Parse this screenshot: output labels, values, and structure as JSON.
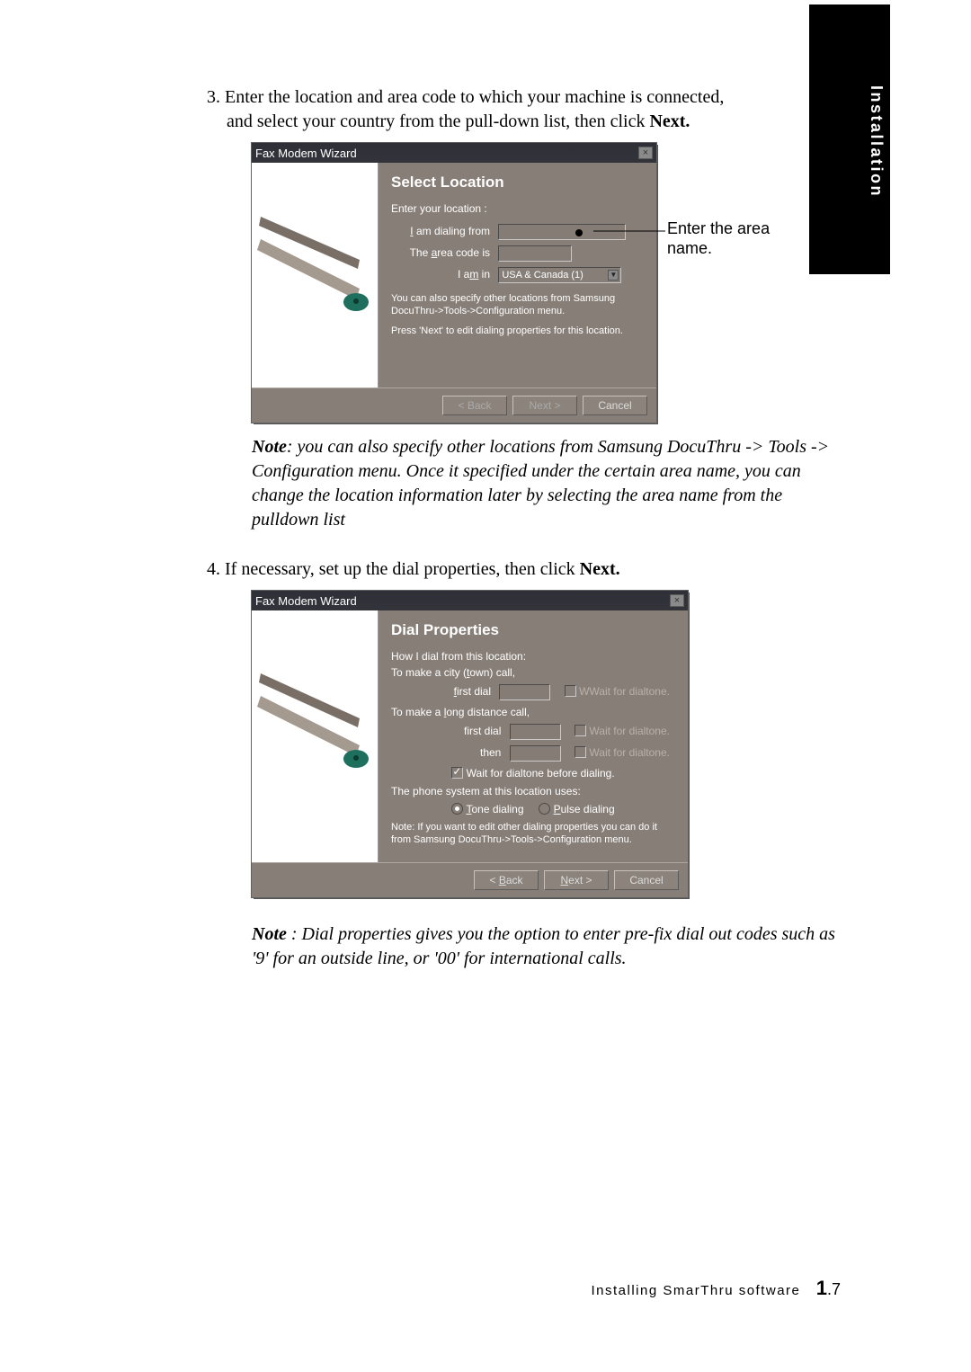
{
  "sideLabel": "Installation",
  "step3": {
    "lead": "3. Enter the location and area code to which your machine is connected,",
    "cont": "and select your country from the pull-down list, then click ",
    "nextWord": "Next."
  },
  "callout": {
    "line1": "Enter the area",
    "line2": "name."
  },
  "wiz1": {
    "title": "Fax Modem Wizard",
    "heading": "Select Location",
    "enterLoc": "Enter your location :",
    "dialFrom_u": "I",
    "dialFrom_rest": " am dialing from",
    "areaCode_u": "a",
    "areaCode_pre": "The ",
    "areaCode_post": "rea code is",
    "iamin_u": "m",
    "iamin_pre": "I a",
    "iamin_post": " in",
    "country": "USA & Canada (1)",
    "note1": "You can also specify other locations from Samsung DocuThru->Tools->Configuration menu.",
    "note2": "Press 'Next' to edit dialing properties for this location.",
    "back": "< Back",
    "next": "Next >",
    "cancel": "Cancel"
  },
  "note1": {
    "leadBold": "Note",
    "rest": ": you can also specify other locations from Samsung DocuThru -> Tools -> Configuration menu. Once it specified under the certain area name, you can change the location information later by selecting the area name from the pulldown list"
  },
  "step4": {
    "lead": "4. If necessary, set up the dial properties, then click ",
    "nextWord": "Next."
  },
  "wiz2": {
    "title": "Fax Modem Wizard",
    "heading": "Dial Properties",
    "how": "How I dial from this location:",
    "city_u": "t",
    "city_pre": "To make a city (",
    "city_post": "own) call,",
    "firstDial_u": "f",
    "firstDial_post": "irst dial",
    "wait": "Wait for dialtone.",
    "long_u": "l",
    "long_pre": "To make a ",
    "long_post": "ong distance call,",
    "then": "then",
    "waitBefore": "Wait for dialtone before dialing.",
    "phoneSys": "The phone system at this location uses:",
    "tone_u": "T",
    "tone_post": "one dialing",
    "pulse_u": "P",
    "pulse_post": "ulse dialing",
    "noteLine": "Note: If you want to edit other dialing properties you can do it from Samsung DocuThru->Tools->Configuration menu.",
    "back_u": "B",
    "back_pre": "< ",
    "back_post": "ack",
    "next_u": "N",
    "next_post": "ext >",
    "cancel": "Cancel"
  },
  "note2": {
    "leadBold": "Note",
    "rest": " : Dial properties gives you the option to enter pre-fix dial out codes such as '9' for an outside line, or '00' for international calls."
  },
  "footer": {
    "label": "Installing SmarThru software",
    "chapter": "1",
    "page": ".7"
  }
}
